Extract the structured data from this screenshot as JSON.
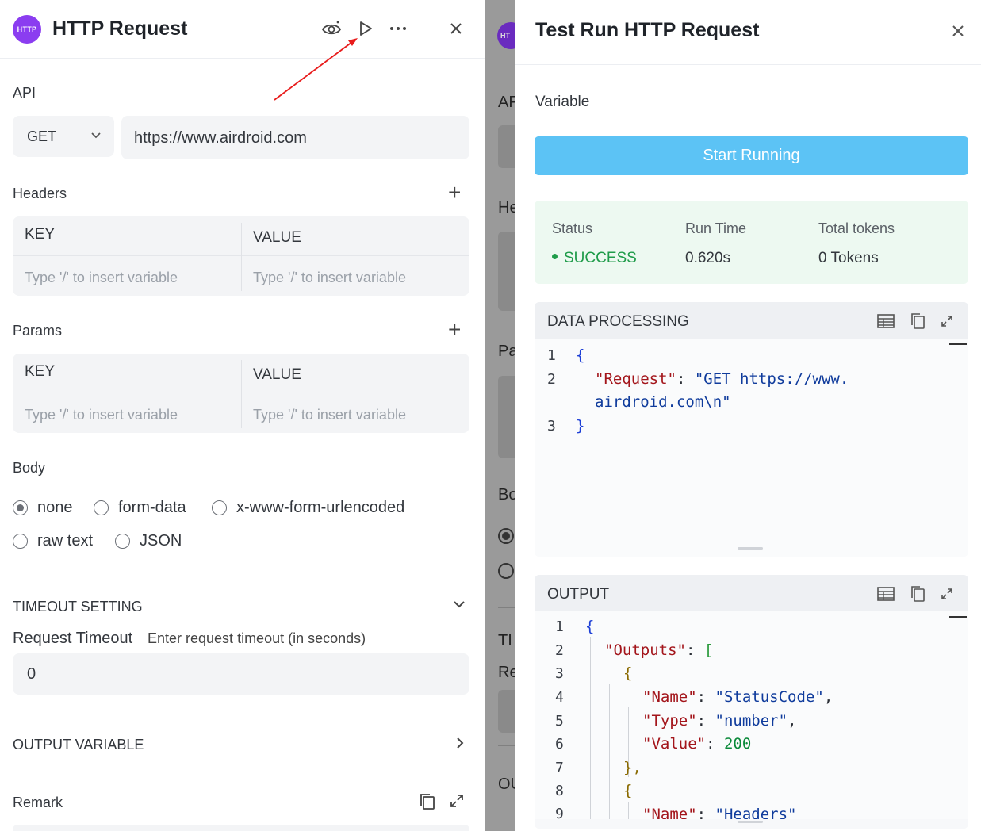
{
  "left_panel": {
    "badge": "HTTP",
    "title": "HTTP Request",
    "api_label": "API",
    "method": "GET",
    "url": "https://www.airdroid.com",
    "headers_label": "Headers",
    "headers_table": {
      "key": "KEY",
      "value": "VALUE",
      "key_placeholder": "Type '/' to insert variable",
      "value_placeholder": "Type '/' to insert variable"
    },
    "params_label": "Params",
    "params_table": {
      "key": "KEY",
      "value": "VALUE",
      "key_placeholder": "Type '/' to insert variable",
      "value_placeholder": "Type '/' to insert variable"
    },
    "body_label": "Body",
    "body_options": [
      {
        "label": "none",
        "selected": true
      },
      {
        "label": "form-data",
        "selected": false
      },
      {
        "label": "x-www-form-urlencoded",
        "selected": false
      },
      {
        "label": "raw text",
        "selected": false
      },
      {
        "label": "JSON",
        "selected": false
      }
    ],
    "timeout_section": "TIMEOUT SETTING",
    "request_timeout_label": "Request Timeout",
    "request_timeout_hint": "Enter request timeout (in seconds)",
    "request_timeout_value": "0",
    "output_variable_label": "OUTPUT VARIABLE",
    "remark_label": "Remark"
  },
  "strip": {
    "badge": "HT",
    "labels": [
      "AP",
      "He",
      "Pa",
      "Bo",
      "TI",
      "Re",
      "OU"
    ]
  },
  "right_panel": {
    "title": "Test Run HTTP Request",
    "variable_label": "Variable",
    "run_button": "Start Running",
    "status": {
      "status_label": "Status",
      "status_value": "SUCCESS",
      "runtime_label": "Run Time",
      "runtime_value": "0.620s",
      "tokens_label": "Total tokens",
      "tokens_value": "0 Tokens"
    },
    "data_processing": {
      "title": "DATA PROCESSING",
      "line_numbers": [
        "1",
        "2",
        "3"
      ],
      "open_brace": "{",
      "key": "\"Request\"",
      "colon": ": ",
      "value_prefix": "\"GET ",
      "value_link_1": "https://www.",
      "value_link_2": "airdroid.com\\n",
      "value_suffix": "\"",
      "close_brace": "}"
    },
    "output": {
      "title": "OUTPUT",
      "line_numbers": [
        "1",
        "2",
        "3",
        "4",
        "5",
        "6",
        "7",
        "8",
        "9"
      ],
      "lines": {
        "l1": "{",
        "l2_key": "\"Outputs\"",
        "l2_rest": ": ",
        "l2_bracket": "[",
        "l3": "{",
        "l4_key": "\"Name\"",
        "l4_val": "\"StatusCode\"",
        "l5_key": "\"Type\"",
        "l5_val": "\"number\"",
        "l6_key": "\"Value\"",
        "l6_val": "200",
        "l7": "},",
        "l8": "{",
        "l9_key": "\"Name\"",
        "l9_val": "\"Headers\""
      }
    }
  },
  "colors": {
    "badge": "#8b3df0",
    "run_button": "#5cc3f5",
    "success": "#1f9c4a",
    "status_bg": "#edf9f1",
    "json_key": "#a3151b",
    "json_string": "#0f3b9c",
    "json_number": "#0b8a3a"
  }
}
